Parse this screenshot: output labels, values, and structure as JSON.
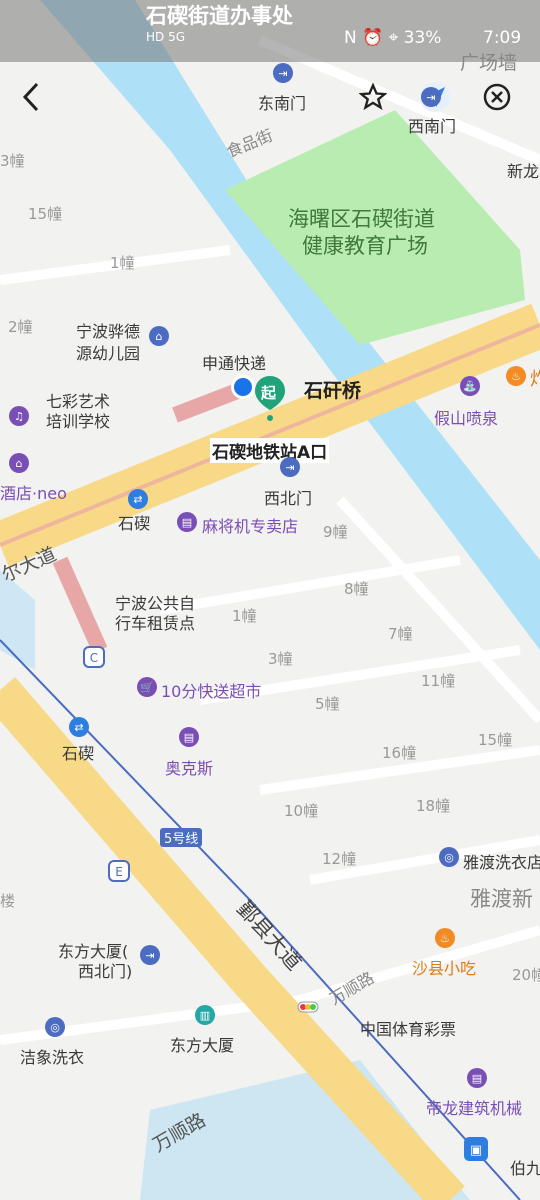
{
  "status_bar": {
    "left_text": "HD 5G",
    "right_text": "N ⏰ ⌖ 33%",
    "time": "7:09",
    "header_street": "石碶街道办事处"
  },
  "top_bar": {
    "back": "back",
    "favorite": "favorite",
    "locate": "locate",
    "close": "close"
  },
  "map_labels": {
    "dongnanmen": "东南门",
    "xinanmen": "西南门",
    "shipinjie": "食品街",
    "plaza_line1": "海曙区石碶街道",
    "plaza_line2": "健康教育广场",
    "guangchangqiang": "广场墙",
    "xinlong": "新龙",
    "kindergarten_line1": "宁波骅德",
    "kindergarten_line2": "源幼儿园",
    "express": "申通快递",
    "school_line1": "七彩艺术",
    "school_line2": "培训学校",
    "hotel": "酒店·neo",
    "bridge": "石矸桥",
    "metro_exit": "石碶地铁站A口",
    "start_marker": "起",
    "xibeimen": "西北门",
    "shiqi1": "石碶",
    "mahjong": "麻将机专卖店",
    "jiaqishan": "假山喷泉",
    "fuel": "炸",
    "road_left": "尔大道",
    "bike_line1": "宁波公共自",
    "bike_line2": "行车租赁点",
    "market": "10分快送超市",
    "okes": "奥克斯",
    "shiqi2": "石碶",
    "line5": "5号线",
    "main_road": "鄞县大道",
    "wanshun1": "万顺路",
    "wanshun2": "万顺路",
    "laundry1": "雅渡洗衣店",
    "yadu": "雅渡新",
    "dongfang_line1": "东方大厦(",
    "dongfang_line2": "西北门)",
    "dongfang2": "东方大厦",
    "shaxian": "沙县小吃",
    "lottery": "中国体育彩票",
    "jiexiang": "洁象洗衣",
    "dilong": "帝龙建筑机械",
    "bai": "伯九",
    "lou": "楼"
  },
  "buildings": [
    "3幢",
    "15幢",
    "1幢",
    "2幢",
    "9幢",
    "8幢",
    "1幢",
    "7幢",
    "3幢",
    "11幢",
    "5幢",
    "16幢",
    "15幢",
    "10幢",
    "18幢",
    "12幢",
    "20幢"
  ],
  "colors": {
    "water": "#aee0f7",
    "park": "#b9ecb0",
    "road_main": "#f7d988",
    "road_red": "#e8a7a7",
    "accent_purple": "#7a4fb5",
    "accent_blue": "#2e7de0",
    "start_green": "#21a37a"
  }
}
